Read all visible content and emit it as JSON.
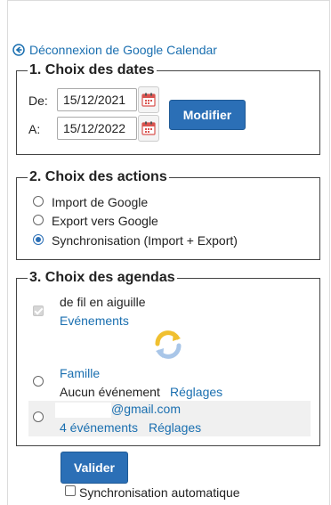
{
  "header": {
    "disconnect_label": "Déconnexion de Google Calendar"
  },
  "dates": {
    "legend": "1. Choix des dates",
    "from_label": "De:",
    "from_value": "15/12/2021",
    "to_label": "A:",
    "to_value": "15/12/2022",
    "modify_label": "Modifier"
  },
  "actions": {
    "legend": "2. Choix des actions",
    "options": [
      {
        "label": "Import de Google",
        "selected": false
      },
      {
        "label": "Export vers Google",
        "selected": false
      },
      {
        "label": "Synchronisation (Import + Export)",
        "selected": true
      }
    ]
  },
  "agendas": {
    "legend": "3. Choix des agendas",
    "local": {
      "name": "de fil en aiguille",
      "events_link": "Evénements",
      "checked": true,
      "disabled": true
    },
    "google": [
      {
        "name": "Famille",
        "status": "Aucun événement",
        "settings": "Réglages",
        "selected": false
      },
      {
        "name": "@gmail.com",
        "status": "4 événements",
        "settings": "Réglages",
        "selected": false
      }
    ]
  },
  "footer": {
    "submit_label": "Valider",
    "auto_sync_label": "Synchronisation automatique",
    "auto_sync_checked": false
  },
  "colors": {
    "accent": "#2b6fb6",
    "link": "#1a6fb0",
    "calendar_red": "#d9534f",
    "sync_yellow": "#f0c030",
    "sync_blue": "#a9c6e8"
  }
}
